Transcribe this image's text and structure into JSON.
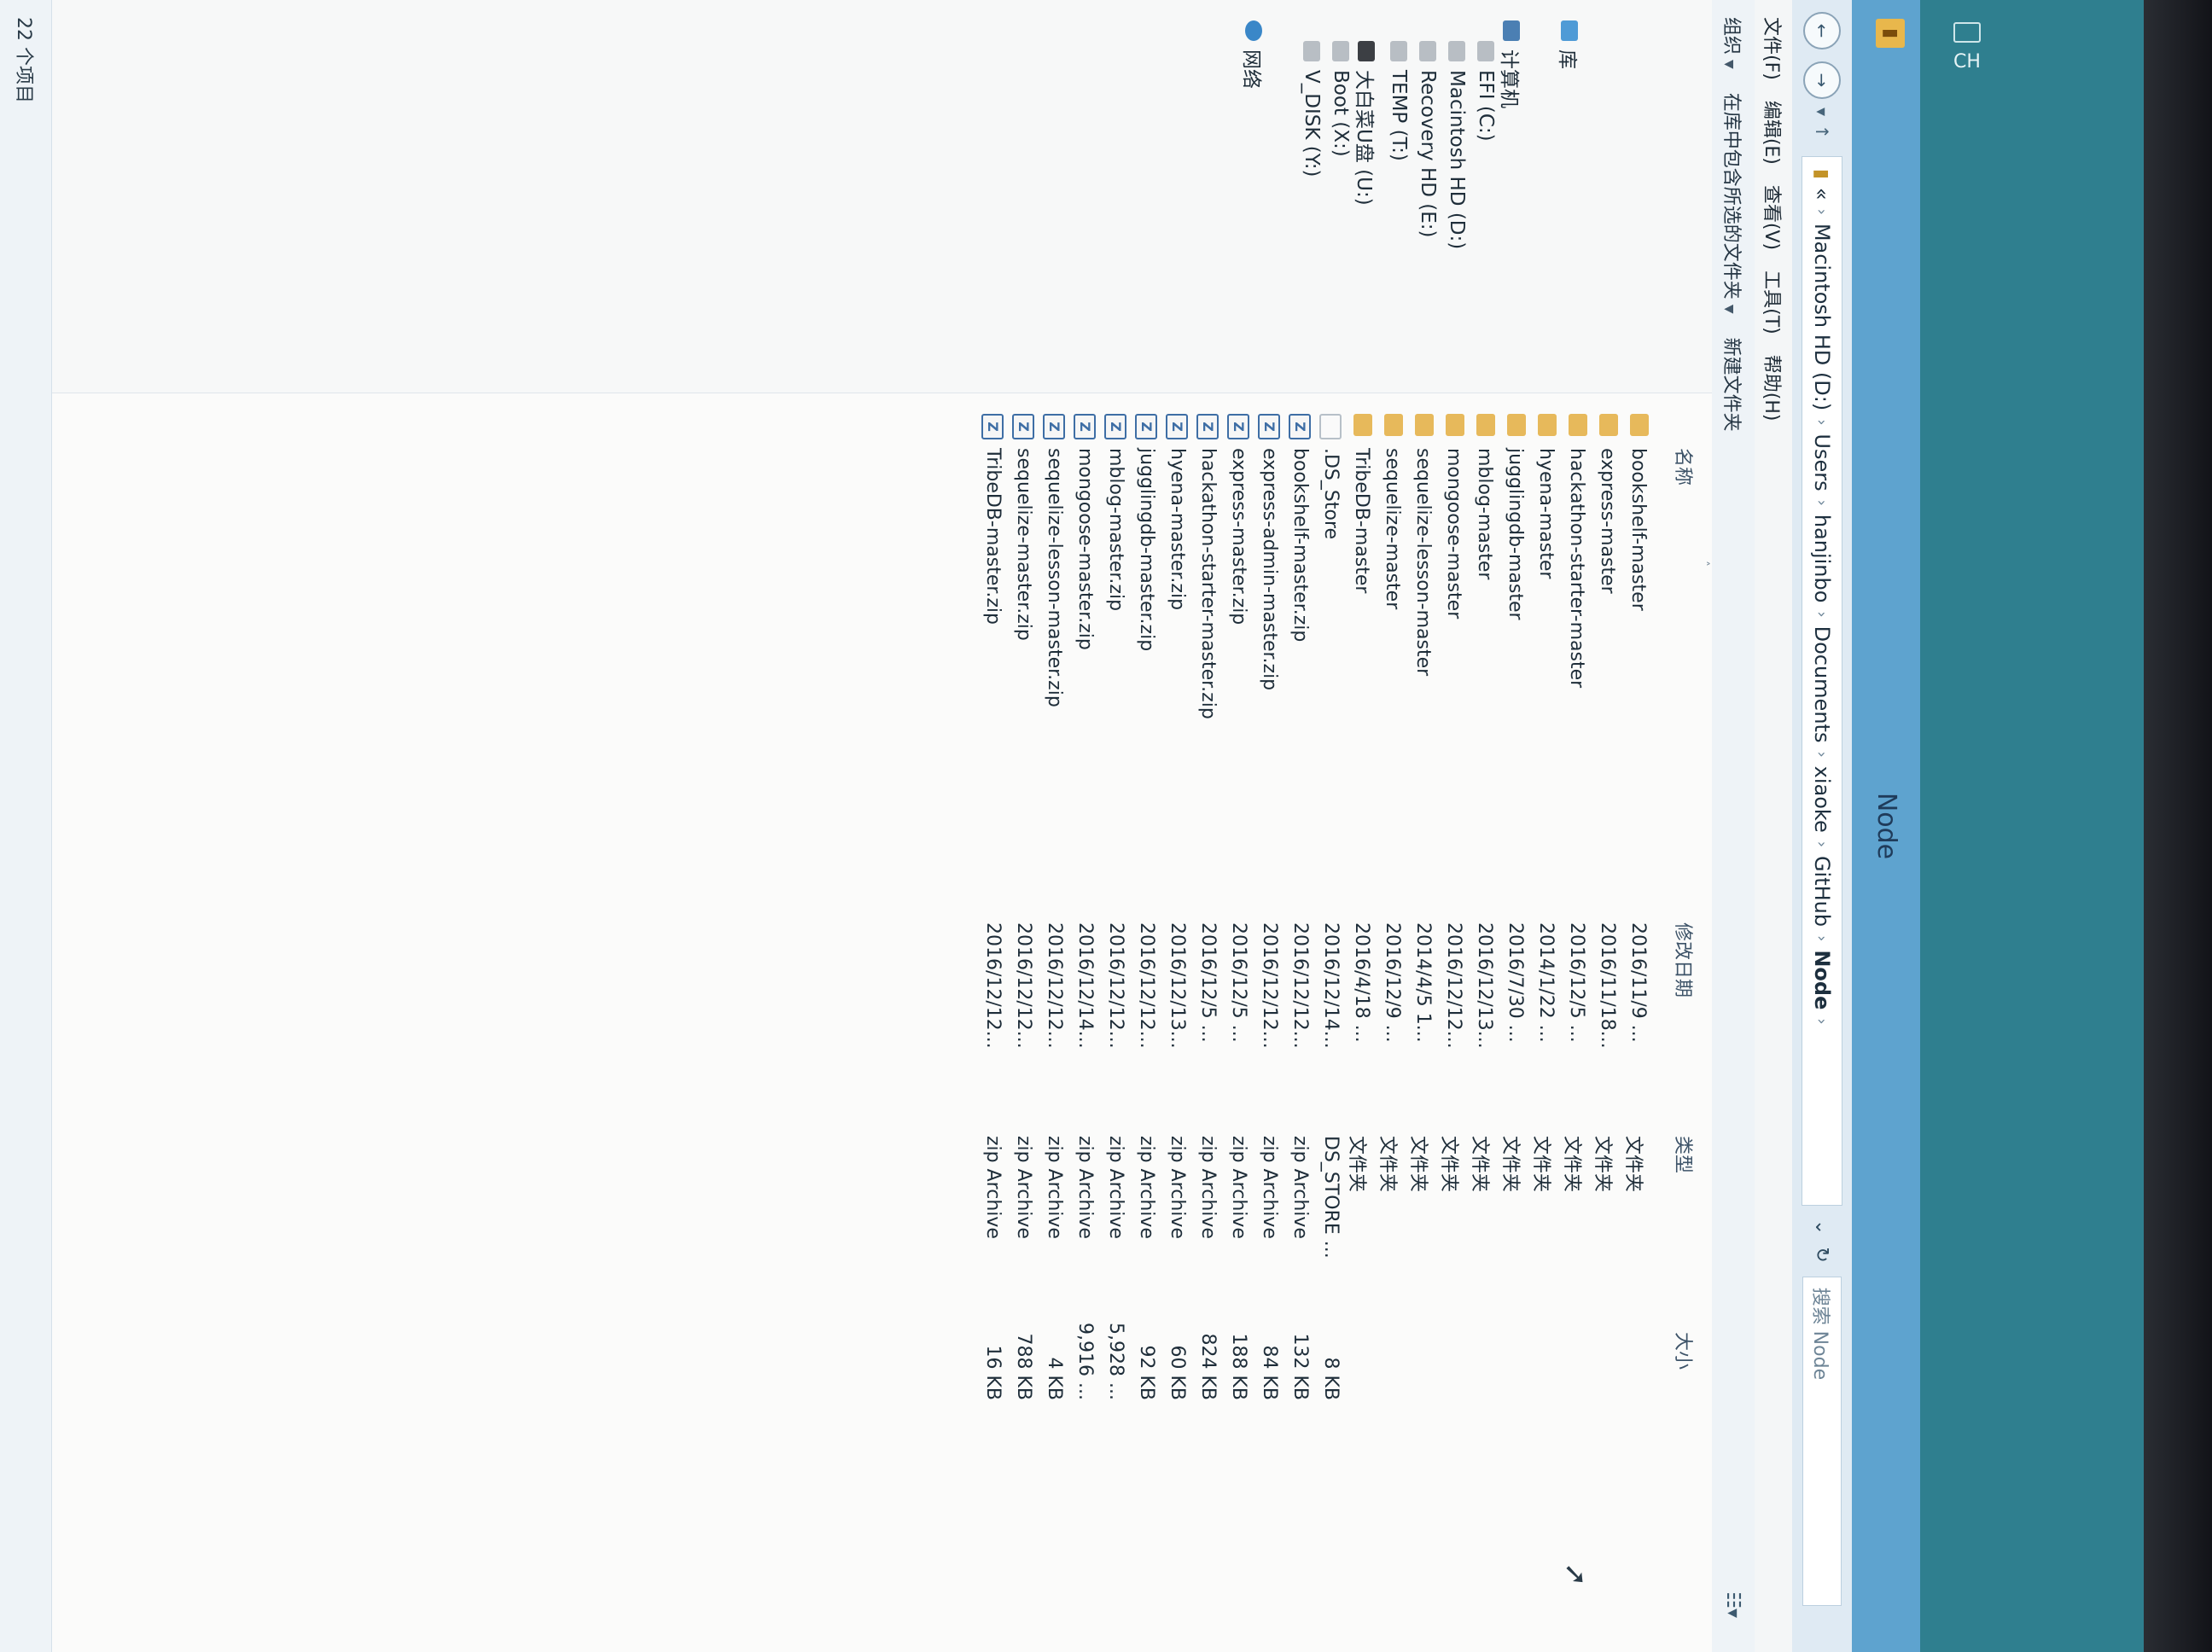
{
  "window": {
    "title": "Node"
  },
  "breadcrumb": {
    "items": [
      "Macintosh HD (D:)",
      "Users",
      "hanjinbo",
      "Documents",
      "xiaoke",
      "GitHub",
      "Node"
    ],
    "overflow": "«",
    "separator": "›"
  },
  "search": {
    "placeholder": "搜索 Node"
  },
  "menubar": {
    "items": [
      "文件(F)",
      "编辑(E)",
      "查看(V)",
      "工具(T)",
      "帮助(H)"
    ]
  },
  "toolbar": {
    "items": [
      "组织",
      "在库中包含所选的文件夹",
      "新建文件夹"
    ]
  },
  "nav": {
    "items": [
      {
        "label": "库",
        "icon": "library-icon"
      },
      {
        "label": "计算机",
        "icon": "computer-icon"
      },
      {
        "label": "EFI (C:)",
        "icon": "drive-icon"
      },
      {
        "label": "Macintosh HD (D:)",
        "icon": "drive-icon"
      },
      {
        "label": "Recovery HD (E:)",
        "icon": "drive-icon"
      },
      {
        "label": "TEMP (T:)",
        "icon": "drive-icon"
      },
      {
        "label": "大白菜U盘 (U:)",
        "icon": "usb-drive-icon"
      },
      {
        "label": "Boot (X:)",
        "icon": "drive-icon"
      },
      {
        "label": "V_DISK (Y:)",
        "icon": "drive-icon"
      },
      {
        "label": "网络",
        "icon": "network-icon"
      }
    ]
  },
  "columns": {
    "name": "名称",
    "date": "修改日期",
    "type": "类型",
    "size": "大小"
  },
  "files": [
    {
      "name": "bookshelf-master",
      "date": "2016/11/9 ...",
      "type": "文件夹",
      "size": "",
      "icon": "folder-icon"
    },
    {
      "name": "express-master",
      "date": "2016/11/18...",
      "type": "文件夹",
      "size": "",
      "icon": "folder-icon"
    },
    {
      "name": "hackathon-starter-master",
      "date": "2016/12/5 ...",
      "type": "文件夹",
      "size": "",
      "icon": "folder-icon"
    },
    {
      "name": "hyena-master",
      "date": "2014/1/22 ...",
      "type": "文件夹",
      "size": "",
      "icon": "folder-icon"
    },
    {
      "name": "jugglingdb-master",
      "date": "2016/7/30 ...",
      "type": "文件夹",
      "size": "",
      "icon": "folder-icon"
    },
    {
      "name": "mblog-master",
      "date": "2016/12/13...",
      "type": "文件夹",
      "size": "",
      "icon": "folder-icon"
    },
    {
      "name": "mongoose-master",
      "date": "2016/12/12...",
      "type": "文件夹",
      "size": "",
      "icon": "folder-icon"
    },
    {
      "name": "sequelize-lesson-master",
      "date": "2014/4/5 1...",
      "type": "文件夹",
      "size": "",
      "icon": "folder-icon"
    },
    {
      "name": "sequelize-master",
      "date": "2016/12/9 ...",
      "type": "文件夹",
      "size": "",
      "icon": "folder-icon"
    },
    {
      "name": "TribeDB-master",
      "date": "2016/4/18 ...",
      "type": "文件夹",
      "size": "",
      "icon": "folder-icon"
    },
    {
      "name": ".DS_Store",
      "date": "2016/12/14...",
      "type": "DS_STORE ...",
      "size": "8 KB",
      "icon": "file-icon"
    },
    {
      "name": "bookshelf-master.zip",
      "date": "2016/12/12...",
      "type": "zip Archive",
      "size": "132 KB",
      "icon": "zip-icon"
    },
    {
      "name": "express-admin-master.zip",
      "date": "2016/12/12...",
      "type": "zip Archive",
      "size": "84 KB",
      "icon": "zip-icon"
    },
    {
      "name": "express-master.zip",
      "date": "2016/12/5 ...",
      "type": "zip Archive",
      "size": "188 KB",
      "icon": "zip-icon"
    },
    {
      "name": "hackathon-starter-master.zip",
      "date": "2016/12/5 ...",
      "type": "zip Archive",
      "size": "824 KB",
      "icon": "zip-icon"
    },
    {
      "name": "hyena-master.zip",
      "date": "2016/12/13...",
      "type": "zip Archive",
      "size": "60 KB",
      "icon": "zip-icon"
    },
    {
      "name": "jugglingdb-master.zip",
      "date": "2016/12/12...",
      "type": "zip Archive",
      "size": "92 KB",
      "icon": "zip-icon"
    },
    {
      "name": "mblog-master.zip",
      "date": "2016/12/12...",
      "type": "zip Archive",
      "size": "5,928 ...",
      "icon": "zip-icon"
    },
    {
      "name": "mongoose-master.zip",
      "date": "2016/12/14...",
      "type": "zip Archive",
      "size": "9,916 ...",
      "icon": "zip-icon"
    },
    {
      "name": "sequelize-lesson-master.zip",
      "date": "2016/12/12...",
      "type": "zip Archive",
      "size": "4 KB",
      "icon": "zip-icon"
    },
    {
      "name": "sequelize-master.zip",
      "date": "2016/12/12...",
      "type": "zip Archive",
      "size": "788 KB",
      "icon": "zip-icon"
    },
    {
      "name": "TribeDB-master.zip",
      "date": "2016/12/12...",
      "type": "zip Archive",
      "size": "16 KB",
      "icon": "zip-icon"
    }
  ],
  "status": {
    "text": "22 个项目"
  },
  "tray": {
    "lang": "CH"
  }
}
